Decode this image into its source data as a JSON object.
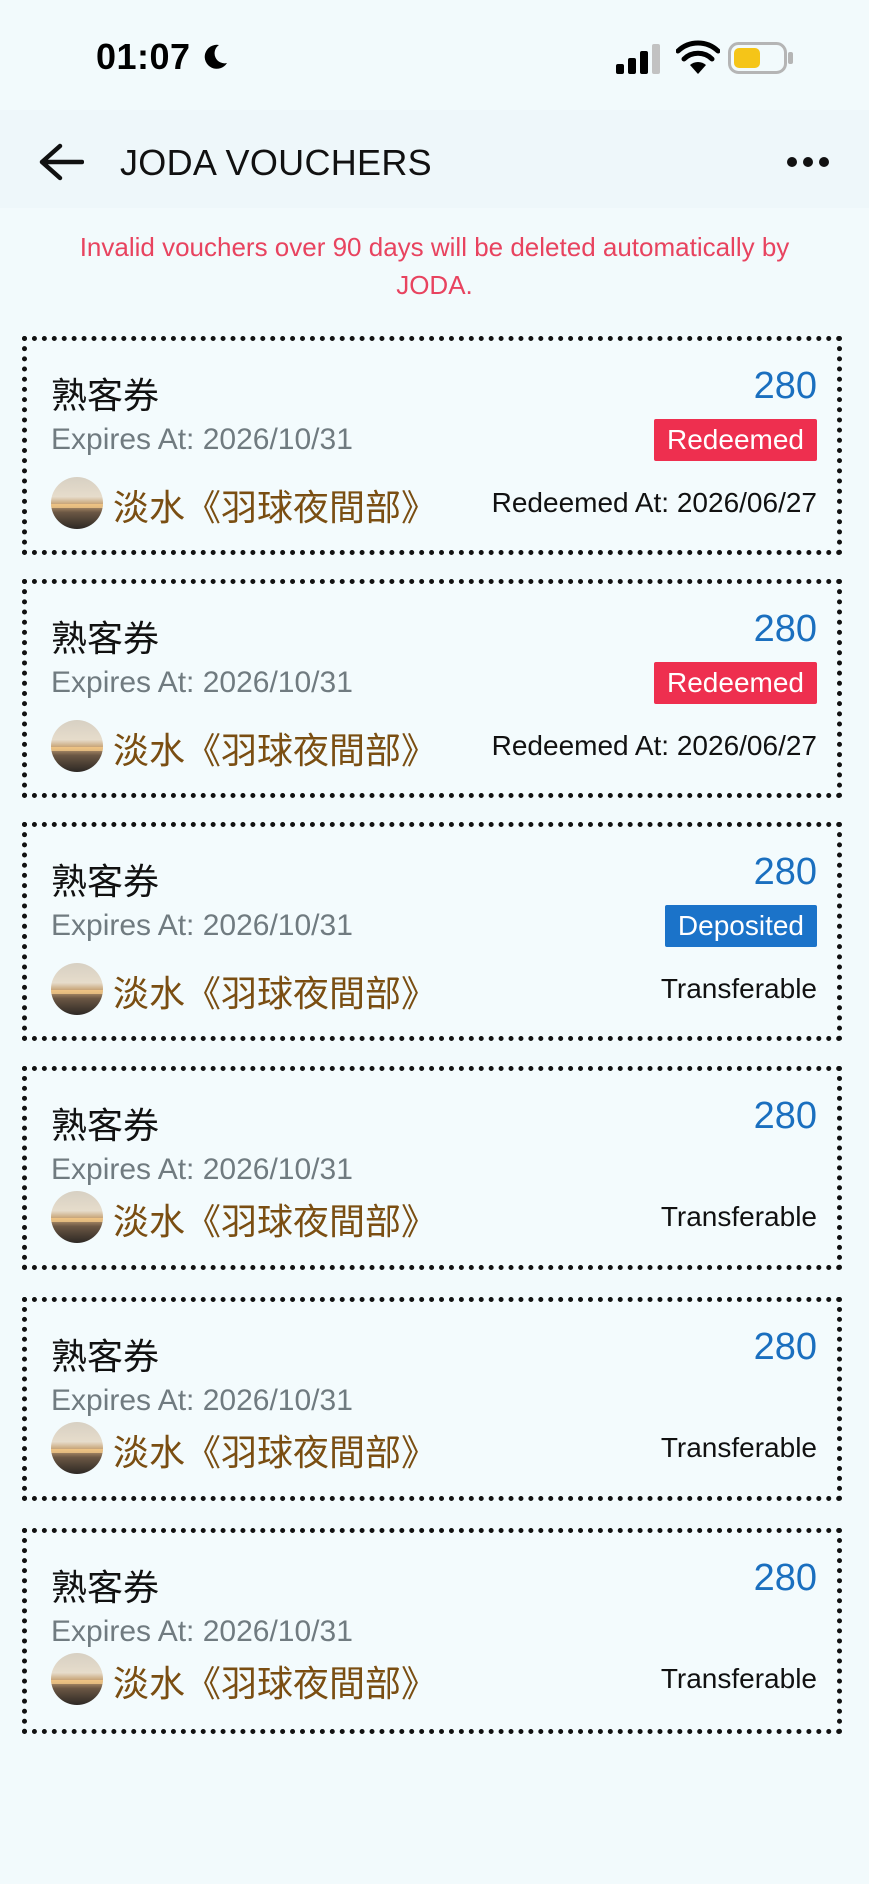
{
  "status_bar": {
    "time": "01:07"
  },
  "header": {
    "title": "JODA VOUCHERS"
  },
  "notice": "Invalid vouchers over 90 days will be deleted automatically by JODA.",
  "vouchers": [
    {
      "name": "熟客券",
      "amount": "280",
      "expires": "Expires At: 2026/10/31",
      "status": "Redeemed",
      "merchant": "淡水《羽球夜間部》",
      "right_text": "Redeemed At: 2026/06/27"
    },
    {
      "name": "熟客券",
      "amount": "280",
      "expires": "Expires At: 2026/10/31",
      "status": "Redeemed",
      "merchant": "淡水《羽球夜間部》",
      "right_text": "Redeemed At: 2026/06/27"
    },
    {
      "name": "熟客券",
      "amount": "280",
      "expires": "Expires At: 2026/10/31",
      "status": "Deposited",
      "merchant": "淡水《羽球夜間部》",
      "right_text": "Transferable"
    },
    {
      "name": "熟客券",
      "amount": "280",
      "expires": "Expires At: 2026/10/31",
      "status": "",
      "merchant": "淡水《羽球夜間部》",
      "right_text": "Transferable"
    },
    {
      "name": "熟客券",
      "amount": "280",
      "expires": "Expires At: 2026/10/31",
      "status": "",
      "merchant": "淡水《羽球夜間部》",
      "right_text": "Transferable"
    },
    {
      "name": "熟客券",
      "amount": "280",
      "expires": "Expires At: 2026/10/31",
      "status": "",
      "merchant": "淡水《羽球夜間部》",
      "right_text": "Transferable"
    }
  ],
  "icons": {
    "moon": "moon-icon",
    "signal": "cellular-signal-icon",
    "wifi": "wifi-icon",
    "battery": "battery-icon",
    "back": "back-arrow-icon",
    "more": "more-options-icon"
  },
  "colors": {
    "accent_blue": "#1a6fbf",
    "redeemed_badge": "#ee2f4f",
    "deposited_badge": "#1b73c9",
    "notice_text": "#e8435f",
    "merchant_text": "#7a4e12",
    "battery_fill": "#f5c518"
  }
}
